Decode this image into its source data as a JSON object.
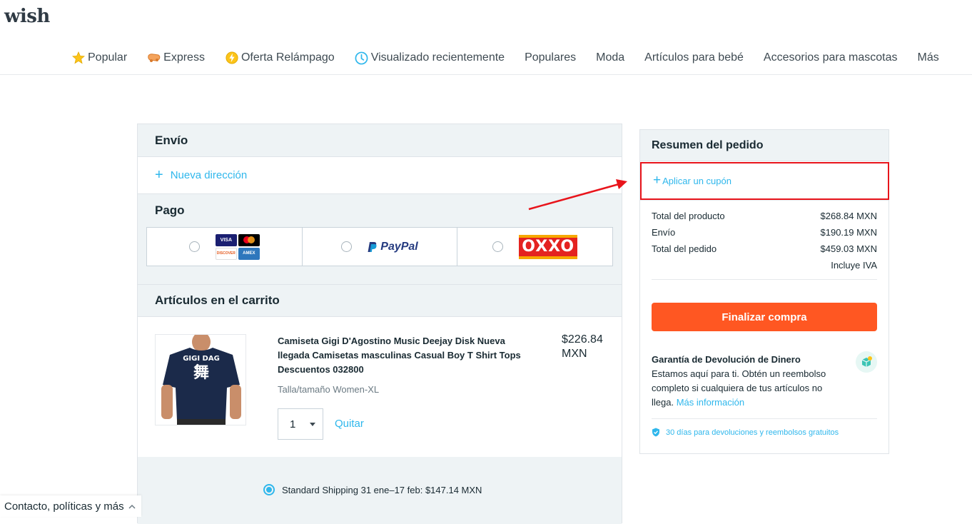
{
  "brand": {
    "logo": "wish"
  },
  "nav": {
    "items": [
      {
        "label": "Popular",
        "icon": "star-icon"
      },
      {
        "label": "Express",
        "icon": "express-truck-icon"
      },
      {
        "label": "Oferta Relámpago",
        "icon": "lightning-icon"
      },
      {
        "label": "Visualizado recientemente",
        "icon": "clock-icon"
      },
      {
        "label": "Populares"
      },
      {
        "label": "Moda"
      },
      {
        "label": "Artículos para bebé"
      },
      {
        "label": "Accesorios para mascotas"
      },
      {
        "label": "Más"
      }
    ]
  },
  "shipping": {
    "title": "Envío",
    "new_address": "Nueva dirección"
  },
  "payment": {
    "title": "Pago",
    "options": [
      {
        "name": "cards",
        "selected": false,
        "labels": [
          "VISA",
          "MC",
          "DISCOVER",
          "AMEX"
        ]
      },
      {
        "name": "paypal",
        "selected": false,
        "label": "PayPal"
      },
      {
        "name": "oxxo",
        "selected": false,
        "label": "OXXO"
      }
    ]
  },
  "cart": {
    "title": "Artículos en el carrito",
    "item": {
      "title": "Camiseta Gigi D'Agostino Music Deejay Disk Nueva llegada Camisetas masculinas Casual Boy T Shirt Tops Descuentos 032800",
      "price": "$226.84 MXN",
      "size": "Talla/tamaño Women-XL",
      "quantity": "1",
      "remove": "Quitar",
      "shirt_print": "GIGI DAG"
    },
    "shipping_option": "Standard Shipping 31 ene–17 feb: $147.14 MXN"
  },
  "summary": {
    "title": "Resumen del pedido",
    "coupon": "Aplicar un cupón",
    "rows": [
      {
        "label": "Total del producto",
        "value": "$268.84 MXN"
      },
      {
        "label": "Envío",
        "value": "$190.19 MXN"
      },
      {
        "label": "Total del pedido",
        "value": "$459.03 MXN"
      }
    ],
    "tax_note": "Incluye IVA",
    "checkout": "Finalizar compra",
    "guarantee": {
      "title": "Garantía de Devolución de Dinero",
      "body": "Estamos aquí para ti. Obtén un reembolso completo si cualquiera de tus artículos no llega.",
      "link": "Más información",
      "returns": "30 días para devoluciones y reembolsos gratuitos"
    }
  },
  "footer": {
    "label": "Contacto, políticas y más"
  },
  "colors": {
    "accent": "#2fb7ec",
    "checkout": "#ff5722",
    "highlight": "#e8141b"
  }
}
